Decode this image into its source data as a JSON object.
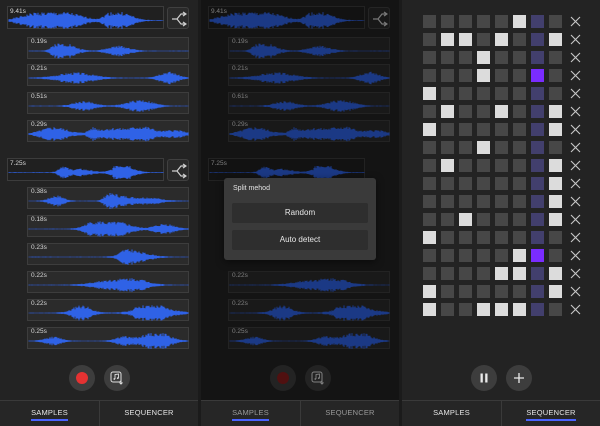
{
  "samples_screen": {
    "group1": {
      "main_duration": "9.41s",
      "samples": [
        "0.19s",
        "0.21s",
        "0.51s",
        "0.29s"
      ]
    },
    "group2": {
      "main_duration": "7.25s",
      "samples": [
        "0.38s",
        "0.18s",
        "0.23s",
        "0.22s",
        "0.22s",
        "0.25s"
      ]
    }
  },
  "split_screen": {
    "group1": {
      "main_duration": "9.41s",
      "samples": [
        "0.19s",
        "0.21s",
        "0.61s",
        "0.29s"
      ]
    },
    "group2": {
      "main_duration": "7.25s",
      "samples": [
        "0.22s",
        "0.22s",
        "0.25s"
      ]
    },
    "popup": {
      "title": "Split mehod",
      "random_label": "Random",
      "auto_detect_label": "Auto detect"
    }
  },
  "tabs": {
    "samples_label": "SAMPLES",
    "sequencer_label": "SEQUENCER"
  },
  "sequencer": {
    "rows": 16,
    "columns": 8,
    "selected_column": 6,
    "active_cells": [
      [
        0,
        5
      ],
      [
        1,
        1
      ],
      [
        1,
        2
      ],
      [
        1,
        4
      ],
      [
        1,
        7
      ],
      [
        2,
        3
      ],
      [
        3,
        3
      ],
      [
        3,
        6
      ],
      [
        4,
        0
      ],
      [
        5,
        1
      ],
      [
        5,
        4
      ],
      [
        5,
        7
      ],
      [
        6,
        0
      ],
      [
        6,
        7
      ],
      [
        7,
        3
      ],
      [
        8,
        1
      ],
      [
        8,
        7
      ],
      [
        9,
        7
      ],
      [
        10,
        7
      ],
      [
        11,
        2
      ],
      [
        11,
        7
      ],
      [
        12,
        0
      ],
      [
        13,
        5
      ],
      [
        13,
        6
      ],
      [
        14,
        4
      ],
      [
        14,
        5
      ],
      [
        14,
        7
      ],
      [
        15,
        0
      ],
      [
        15,
        7
      ],
      [
        16,
        0
      ],
      [
        16,
        3
      ],
      [
        16,
        4
      ],
      [
        16,
        5
      ]
    ]
  },
  "colors": {
    "wave_blue": "#2f62e6",
    "accent_purple": "#7a2cff",
    "record_red": "#e53232",
    "tab_underline": "#4a63ff"
  },
  "icons": {
    "split": "split-icon",
    "record": "record-dot-icon",
    "import": "import-music-icon",
    "pause": "pause-icon",
    "add": "plus-icon",
    "remove_row": "close-icon"
  }
}
